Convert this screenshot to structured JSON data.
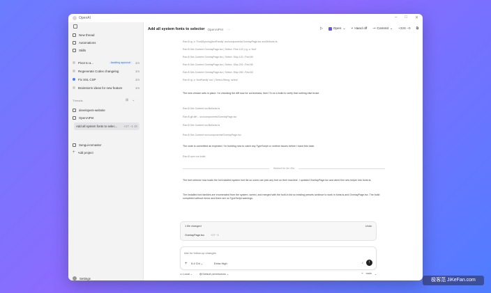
{
  "app": {
    "title": "OpenAI"
  },
  "window": {
    "minimize": "–",
    "maximize": "□",
    "close": "✕"
  },
  "sidebar": {
    "actions": [
      {
        "label": "New thread",
        "icon": "edit-icon"
      },
      {
        "label": "Automations",
        "icon": "clock-icon"
      },
      {
        "label": "Skills",
        "icon": "grid-icon"
      }
    ],
    "tasks": [
      {
        "label": "Pivot to a...",
        "badge": "Awaiting approval",
        "meta": "1m"
      },
      {
        "label": "Regenerate Codex changelog",
        "meta": "1m"
      },
      {
        "label": "Fix SSL CSP",
        "meta": "1m"
      },
      {
        "label": "Brainstorm ideas for new feature",
        "meta": "1m"
      }
    ],
    "threads_label": "Threads",
    "threads": [
      {
        "label": "developers-website"
      },
      {
        "label": "OpenAIPet"
      },
      {
        "label": "Add all system fonts to selec...",
        "meta": "+17 −1 1h"
      },
      {
        "label": "Sengui-remaster"
      },
      {
        "label": "Add project"
      }
    ],
    "settings_label": "Settings"
  },
  "topbar": {
    "title": "Add all system fonts to selector",
    "subtitle": "OpenAIPet",
    "more": "···",
    "open_label": "Open",
    "handoff_label": "Hand off",
    "commit_label": "Commit",
    "diff": "+326 −0"
  },
  "content": {
    "log": [
      "Ran $ rg -n ‘Font|Syncing|fontFamily’ src/components/OverlayPage.tsx src/lib/fonts.ts",
      "Ran $ Get-Content OverlayPage.tsx | Select -First 120 | rg -n ‘font’",
      "Ran $ Get-Content OverlayPage.tsx | Select -Skip 120 -First 80",
      "Ran $ Get-Content OverlayPage.tsx | Select -Skip 200 -First 80",
      "Ran $ Get-Content OverlayPage.tsx | Select -Skip 280 -First 60",
      "Ran $ rg -n ‘fontFamily’ src/ | Select-String ‘select’"
    ],
    "msg1": "The new version sets in place. I'm checking the diff now for correctness, then I'll run a build to verify that nothing else broke.",
    "log2": [
      "Ran $ Get-Content src/lib/fonts.ts",
      "Ran $ git diff -- src/components/OverlayPage.tsx",
      "Ran $ Get-Content src/lib/fonts.ts",
      "Ran $ Get-Content src/components/OverlayPage.tsx"
    ],
    "msg2": "The code is committed as expected. I'm building now to catch any TypeScript or runtime issues before I hand this back.",
    "log3": "Ran $ npm run build",
    "divider": "Worked for 4m 45s",
    "msg3": "The font selector now loads the full installed system font list so users can pick any font on their machine. I updated OverlayPage.tsx and wired the new helper into fonts.ts.",
    "msg4": "The installed font families are enumerated from the system, sorted, and merged with the built-in list so existing presets continue to work in fonts.ts and OverlayPage.tsx. The build completed without errors and there are no TypeScript warnings."
  },
  "changes": {
    "title": "1 file changed",
    "undo": "Undo",
    "file": "OverlayPage.tsx",
    "stats": "+17 −1"
  },
  "composer": {
    "placeholder": "Ask for follow-up changes",
    "model": "5.4 Chl",
    "reasoning": "Extra High"
  },
  "bottombar": {
    "local": "Local",
    "permissions": "Default permissions",
    "branch": "main"
  },
  "watermark": "极客范 JiKeFan.com"
}
